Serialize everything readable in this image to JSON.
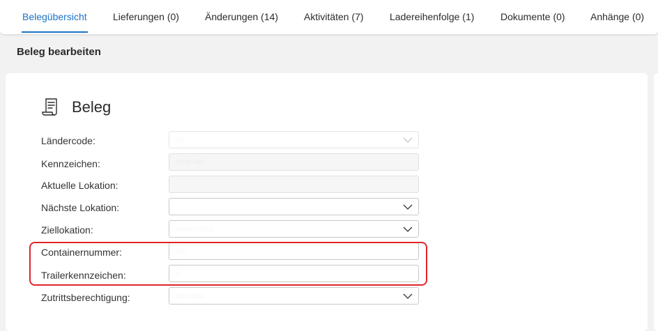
{
  "tabs": [
    {
      "label": "Belegübersicht",
      "active": true
    },
    {
      "label": "Lieferungen (0)",
      "active": false
    },
    {
      "label": "Änderungen (14)",
      "active": false
    },
    {
      "label": "Aktivitäten (7)",
      "active": false
    },
    {
      "label": "Ladereihenfolge (1)",
      "active": false
    },
    {
      "label": "Dokumente (0)",
      "active": false
    },
    {
      "label": "Anhänge (0)",
      "active": false
    }
  ],
  "section": {
    "title": "Beleg bearbeiten"
  },
  "card": {
    "title": "Beleg",
    "icon": "receipt-icon"
  },
  "form": {
    "laendercode": {
      "label": "Ländercode:",
      "value": "···"
    },
    "kennzeichen": {
      "label": "Kennzeichen:",
      "value": "··· ·· ····"
    },
    "aktuelle_lokation": {
      "label": "Aktuelle Lokation:",
      "value": ""
    },
    "naechste_lokation": {
      "label": "Nächste Lokation:",
      "value": ""
    },
    "ziellokation": {
      "label": "Ziellokation:",
      "value": "······ · ··· ·"
    },
    "containernummer": {
      "label": "Containernummer:",
      "value": "·· ·"
    },
    "trailerkennzeichen": {
      "label": "Trailerkennzeichen:",
      "value": "··"
    },
    "zutrittsberechtigung": {
      "label": "Zutrittsberechtigung:",
      "value": "····· ····"
    }
  },
  "colors": {
    "accent": "#1a73c8",
    "highlight": "#e0242b"
  }
}
